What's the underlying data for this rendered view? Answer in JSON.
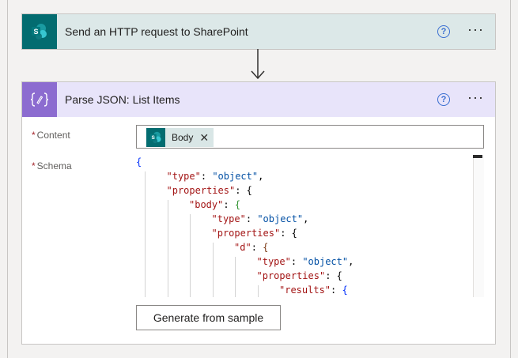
{
  "steps": {
    "sharepoint": {
      "title": "Send an HTTP request to SharePoint",
      "icon": "sharepoint-icon",
      "accent": "#036c70"
    },
    "parse_json": {
      "title": "Parse JSON: List Items",
      "icon": "data-operations-icon",
      "accent": "#8c6cd0",
      "content": {
        "label": "Content",
        "token": {
          "label": "Body",
          "icon": "sharepoint-icon"
        }
      },
      "schema": {
        "label": "Schema",
        "lines": [
          {
            "indent": 0,
            "key": "",
            "value": "",
            "open": "{"
          },
          {
            "indent": 1,
            "key": "\"type\"",
            "value": "\"object\",",
            "open": ""
          },
          {
            "indent": 1,
            "key": "\"properties\"",
            "value": "",
            "open": "{"
          },
          {
            "indent": 2,
            "key": "\"body\"",
            "value": "",
            "open": "{"
          },
          {
            "indent": 3,
            "key": "\"type\"",
            "value": "\"object\",",
            "open": ""
          },
          {
            "indent": 3,
            "key": "\"properties\"",
            "value": "",
            "open": "{"
          },
          {
            "indent": 4,
            "key": "\"d\"",
            "value": "",
            "open": "{"
          },
          {
            "indent": 5,
            "key": "\"type\"",
            "value": "\"object\",",
            "open": ""
          },
          {
            "indent": 5,
            "key": "\"properties\"",
            "value": "",
            "open": "{"
          },
          {
            "indent": 6,
            "key": "\"results\"",
            "value": "",
            "open": "{"
          }
        ]
      },
      "generate_button": "Generate from sample"
    }
  },
  "help_glyph": "?",
  "more_glyph": "···",
  "required_marker": "*",
  "close_glyph": "✕"
}
